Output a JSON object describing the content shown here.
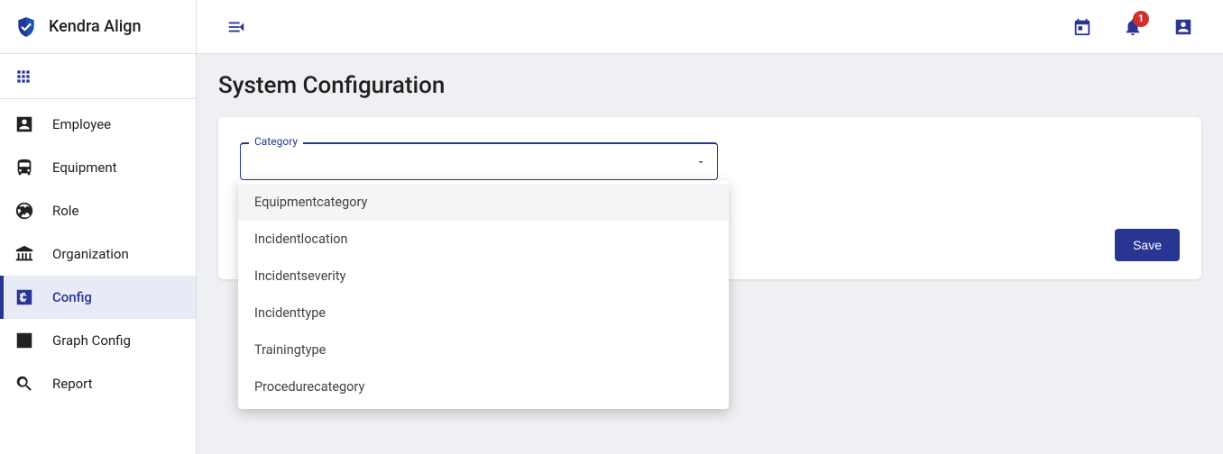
{
  "brand": {
    "name": "Kendra Align"
  },
  "sidebar": {
    "items": [
      {
        "label": "Employee"
      },
      {
        "label": "Equipment"
      },
      {
        "label": "Role"
      },
      {
        "label": "Organization"
      },
      {
        "label": "Config"
      },
      {
        "label": "Graph Config"
      },
      {
        "label": "Report"
      }
    ]
  },
  "topbar": {
    "notification_count": "1"
  },
  "page": {
    "title": "System Configuration"
  },
  "form": {
    "category_label": "Category",
    "category_value": "",
    "category_options": [
      "Equipmentcategory",
      "Incidentlocation",
      "Incidentseverity",
      "Incidenttype",
      "Trainingtype",
      "Procedurecategory"
    ],
    "save_label": "Save"
  }
}
